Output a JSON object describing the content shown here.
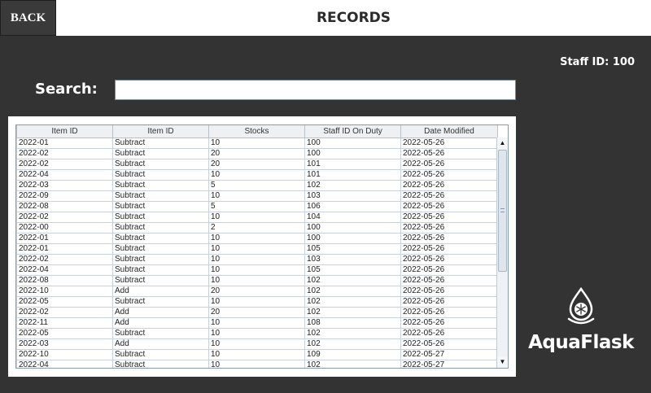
{
  "header": {
    "back_label": "BACK",
    "title": "RECORDS"
  },
  "staff": {
    "label": "Staff ID: 100"
  },
  "search": {
    "label": "Search:",
    "value": ""
  },
  "table": {
    "headers": [
      "Item ID",
      "Item ID",
      "Stocks",
      "Staff ID On Duty",
      "Date Modified"
    ],
    "rows": [
      [
        "2022-01",
        "Subtract",
        "10",
        "100",
        "2022-05-26"
      ],
      [
        "2022-02",
        "Subtract",
        "20",
        "100",
        "2022-05-26"
      ],
      [
        "2022-02",
        "Subtract",
        "20",
        "101",
        "2022-05-26"
      ],
      [
        "2022-04",
        "Subtract",
        "10",
        "101",
        "2022-05-26"
      ],
      [
        "2022-03",
        "Subtract",
        "5",
        "102",
        "2022-05-26"
      ],
      [
        "2022-09",
        "Subtract",
        "10",
        "103",
        "2022-05-26"
      ],
      [
        "2022-08",
        "Subtract",
        "5",
        "106",
        "2022-05-26"
      ],
      [
        "2022-02",
        "Subtract",
        "10",
        "104",
        "2022-05-26"
      ],
      [
        "2022-00",
        "Subtract",
        "2",
        "100",
        "2022-05-26"
      ],
      [
        "2022-01",
        "Subtract",
        "10",
        "100",
        "2022-05-26"
      ],
      [
        "2022-01",
        "Subtract",
        "10",
        "105",
        "2022-05-26"
      ],
      [
        "2022-02",
        "Subtract",
        "10",
        "103",
        "2022-05-26"
      ],
      [
        "2022-04",
        "Subtract",
        "10",
        "105",
        "2022-05-26"
      ],
      [
        "2022-08",
        "Subtract",
        "10",
        "102",
        "2022-05-26"
      ],
      [
        "2022-10",
        "Add",
        "20",
        "102",
        "2022-05-26"
      ],
      [
        "2022-05",
        "Subtract",
        "10",
        "102",
        "2022-05-26"
      ],
      [
        "2022-02",
        "Add",
        "20",
        "102",
        "2022-05-26"
      ],
      [
        "2022-11",
        "Add",
        "10",
        "108",
        "2022-05-26"
      ],
      [
        "2022-05",
        "Subtract",
        "10",
        "102",
        "2022-05-26"
      ],
      [
        "2022-03",
        "Add",
        "10",
        "102",
        "2022-05-26"
      ],
      [
        "2022-10",
        "Subtract",
        "10",
        "109",
        "2022-05-27"
      ],
      [
        "2022-04",
        "Subtract",
        "10",
        "102",
        "2022-05-27"
      ]
    ]
  },
  "scrollbar": {
    "up_glyph": "▲",
    "down_glyph": "▼"
  },
  "brand": {
    "name": "AquaFlask",
    "logo_icon": "water-drop-snowflake-icon"
  },
  "colors": {
    "background": "#333333",
    "header_bg": "#ffffff",
    "back_button_bg": "#3a3a3a"
  }
}
